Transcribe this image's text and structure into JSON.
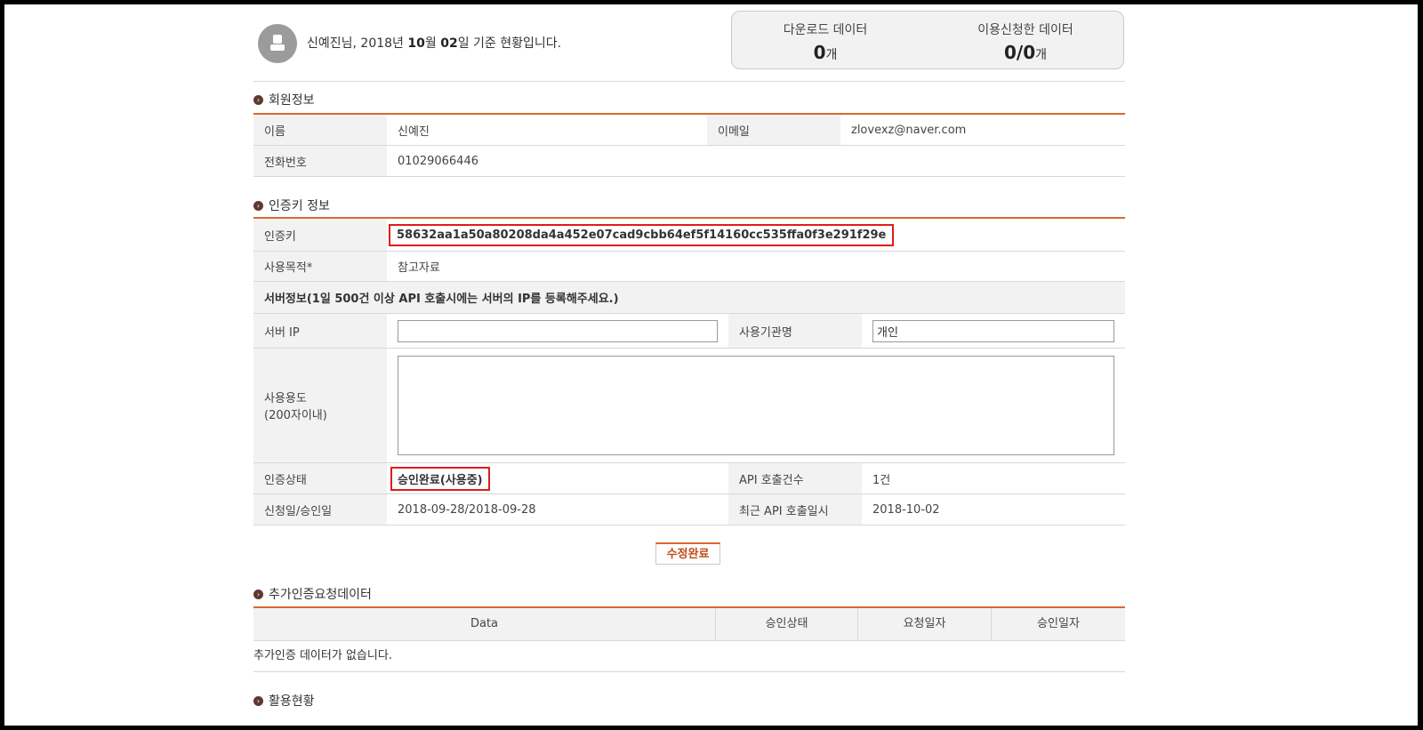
{
  "header": {
    "greeting_pre": "신예진님, 2018년 ",
    "month": "10",
    "greeting_mid1": "월 ",
    "day": "02",
    "greeting_mid2": "일 기준 현황입니다.",
    "stats": [
      {
        "label": "다운로드 데이터",
        "value": "0",
        "unit": "개"
      },
      {
        "label": "이용신청한 데이터",
        "value": "0/0",
        "unit": "개"
      }
    ]
  },
  "member": {
    "title": "회원정보",
    "name_label": "이름",
    "name_value": "신예진",
    "email_label": "이메일",
    "email_value": "zlovexz@naver.com",
    "phone_label": "전화번호",
    "phone_value": "01029066446"
  },
  "authkey": {
    "title": "인증키 정보",
    "key_label": "인증키",
    "key_value": "58632aa1a50a80208da4a452e07cad9cbb64ef5f14160cc535ffa0f3e291f29e",
    "purpose_label": "사용목적*",
    "purpose_value": "참고자료",
    "server_notice": "서버정보(1일 500건 이상 API 호출시에는 서버의 IP를 등록해주세요.)",
    "server_ip_label": "서버 IP",
    "server_ip_value": "",
    "org_label": "사용기관명",
    "org_value": "개인",
    "usage_label_1": "사용용도",
    "usage_label_2": "(200자이내)",
    "usage_value": "",
    "status_label": "인증상태",
    "status_value": "승인완료(사용중)",
    "api_count_label": "API 호출건수",
    "api_count_value": "1건",
    "date_label": "신청일/승인일",
    "date_value": "2018-09-28/2018-09-28",
    "recent_label": "최근 API 호출일시",
    "recent_value": "2018-10-02",
    "submit_label": "수정완료"
  },
  "extra": {
    "title": "추가인증요청데이터",
    "columns": [
      "Data",
      "승인상태",
      "요청일자",
      "승인일자"
    ],
    "empty_text": "추가인증 데이터가 없습니다."
  },
  "usage": {
    "title": "활용현황"
  },
  "colors": {
    "accent": "#d66a2c",
    "highlight_border": "#e01b1b",
    "bullet": "#5c3a2e"
  }
}
